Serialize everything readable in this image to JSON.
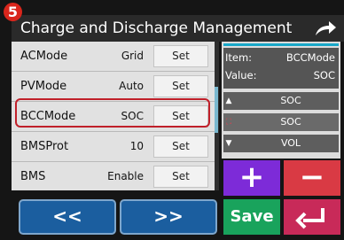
{
  "step_badge": "5",
  "title": "Charge and Discharge Management",
  "rows": [
    {
      "name": "ACMode",
      "value": "Grid",
      "set": "Set"
    },
    {
      "name": "PVMode",
      "value": "Auto",
      "set": "Set"
    },
    {
      "name": "BCCMode",
      "value": "SOC",
      "set": "Set"
    },
    {
      "name": "BMSProt",
      "value": "10",
      "set": "Set"
    },
    {
      "name": "BMS",
      "value": "Enable",
      "set": "Set"
    }
  ],
  "info": {
    "item_label": "Item:",
    "item_value": "BCCMode",
    "value_label": "Value:",
    "value_value": "SOC"
  },
  "options": [
    "SOC",
    "SOC",
    "VOL"
  ],
  "buttons": {
    "plus": "+",
    "minus": "−",
    "save": "Save",
    "prev": "<<",
    "next": ">>"
  },
  "colors": {
    "highlight": "#c0202a",
    "plus": "#7d2bd8",
    "minus": "#d93a44",
    "save": "#19a35c",
    "enter": "#c82a59",
    "nav": "#1b5e9f",
    "accent": "#19a8c9"
  },
  "icons": [
    "share-arrow-icon",
    "scroll-up-icon",
    "expand-icon",
    "scroll-down-icon",
    "enter-return-icon"
  ]
}
